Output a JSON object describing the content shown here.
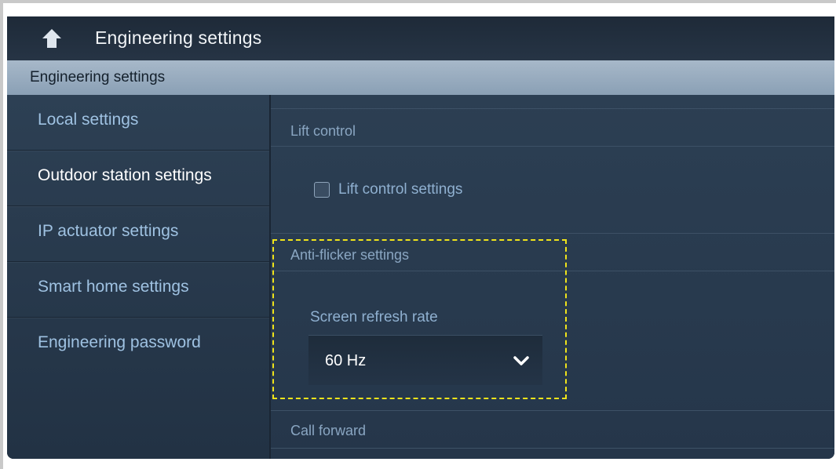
{
  "header": {
    "title": "Engineering settings",
    "back_icon": "back-arrow-icon"
  },
  "section_bar": {
    "label": "Engineering settings"
  },
  "sidebar": {
    "items": [
      {
        "label": "Local settings",
        "active": false
      },
      {
        "label": "Outdoor station settings",
        "active": true
      },
      {
        "label": "IP actuator settings",
        "active": false
      },
      {
        "label": "Smart home settings",
        "active": false
      },
      {
        "label": "Engineering password",
        "active": false
      }
    ]
  },
  "content": {
    "lift_control": {
      "header": "Lift control",
      "checkbox_label": "Lift control settings",
      "checked": false
    },
    "anti_flicker": {
      "header": "Anti-flicker settings",
      "field_label": "Screen refresh rate",
      "selected_value": "60 Hz"
    },
    "call_forward": {
      "header": "Call forward"
    }
  },
  "colors": {
    "highlight": "#f0e41a",
    "section_bar": "#9bb0c4",
    "active_text": "#ffffff",
    "inactive_text": "#9fc2e2"
  }
}
